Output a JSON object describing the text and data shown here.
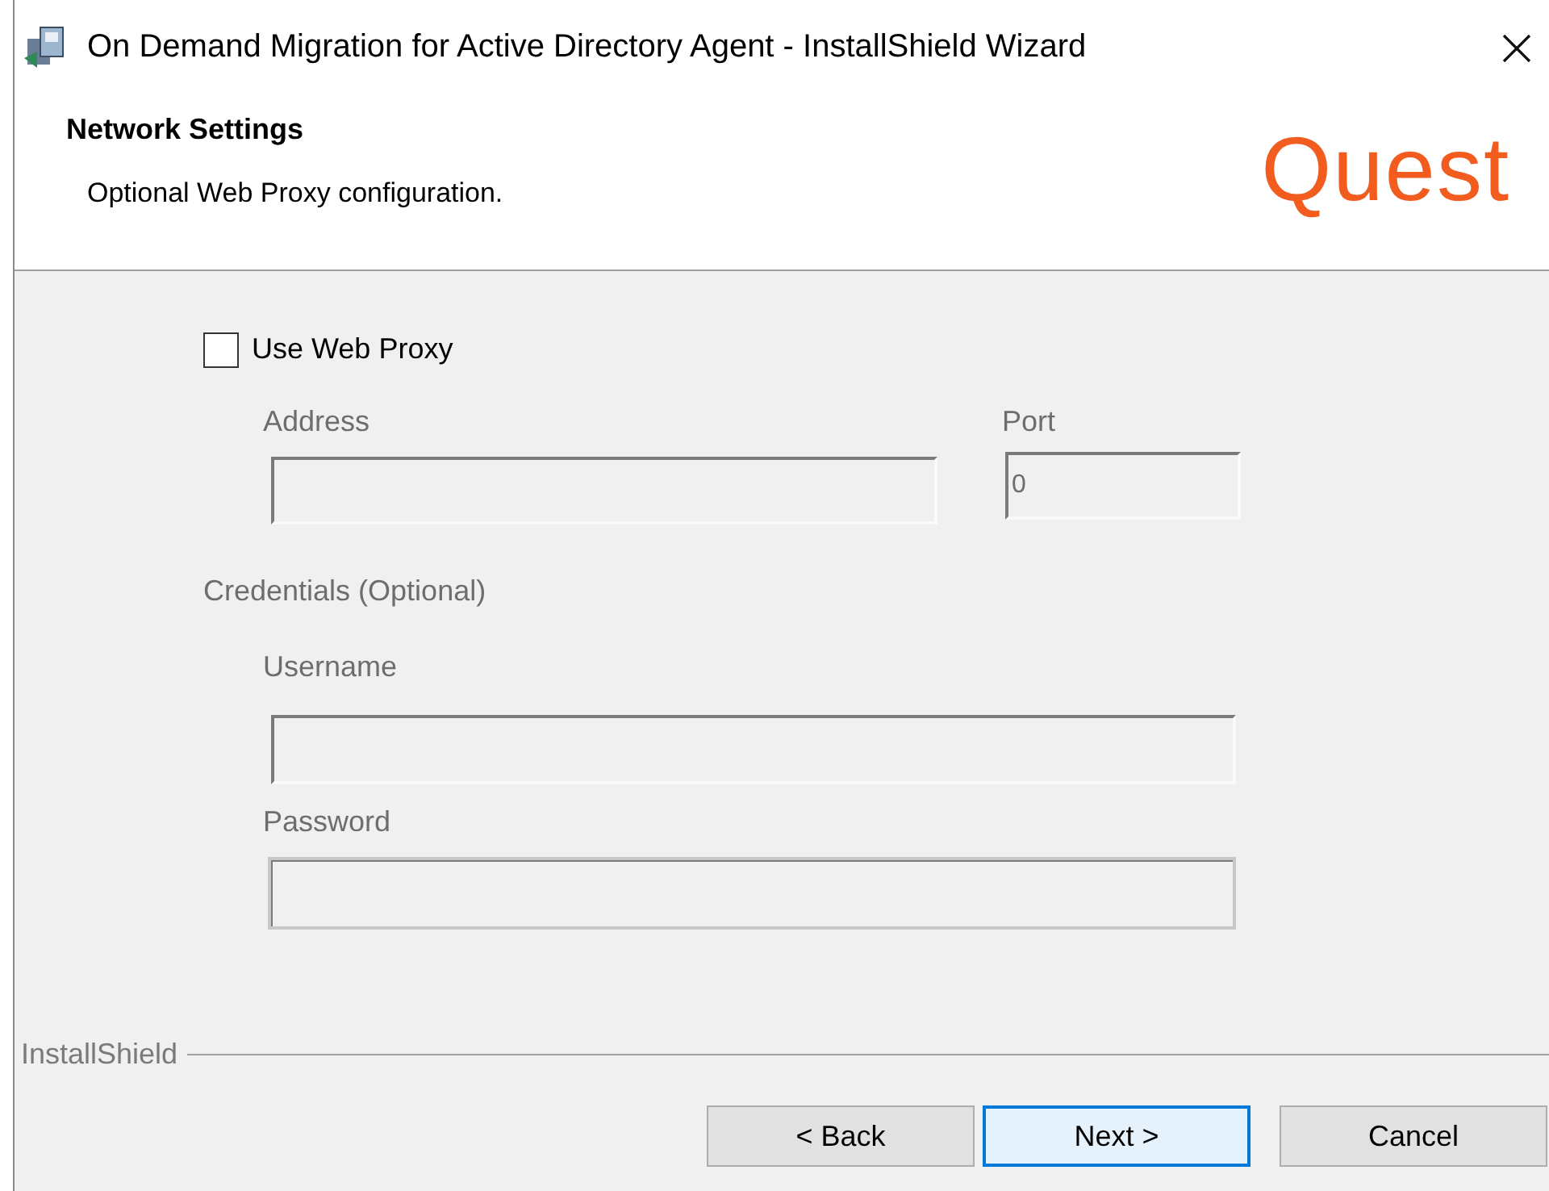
{
  "window": {
    "title": "On Demand Migration for Active Directory Agent - InstallShield Wizard"
  },
  "header": {
    "title": "Network Settings",
    "subtitle": "Optional Web Proxy configuration.",
    "logo": "Quest"
  },
  "proxy_checkbox": {
    "label": "Use Web Proxy",
    "checked": false
  },
  "address": {
    "label": "Address",
    "disabled": true
  },
  "port": {
    "label": "Port",
    "value": "0",
    "disabled": true
  },
  "credentials": {
    "label": "Credentials (Optional)",
    "disabled": true
  },
  "username": {
    "label": "Username",
    "disabled": true
  },
  "password": {
    "label": "Password",
    "disabled": true
  },
  "footer": {
    "brand": "InstallShield"
  },
  "buttons": [
    {
      "label": "< Back",
      "focused": false
    },
    {
      "label": "Next >",
      "focused": true
    },
    {
      "label": "Cancel",
      "focused": false
    }
  ]
}
